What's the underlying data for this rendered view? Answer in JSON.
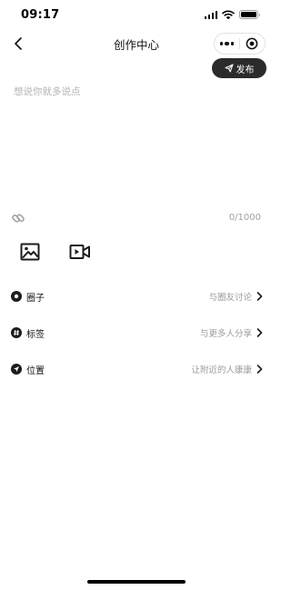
{
  "status_bar": {
    "time": "09:17"
  },
  "nav": {
    "title": "创作中心"
  },
  "publish": {
    "label": "发布"
  },
  "editor": {
    "placeholder": "想说你就多说点",
    "char_count": "0/1000"
  },
  "options": [
    {
      "label": "圈子",
      "hint": "与圈友讨论",
      "icon": "circle-dot-icon"
    },
    {
      "label": "标签",
      "hint": "与更多人分享",
      "icon": "hashtag-icon"
    },
    {
      "label": "位置",
      "hint": "让附近的人康康",
      "icon": "location-arrow-icon"
    }
  ],
  "colors": {
    "dark": "#2b2b2b",
    "hint_text": "#9b9b9b",
    "placeholder": "#b3b3b3"
  }
}
